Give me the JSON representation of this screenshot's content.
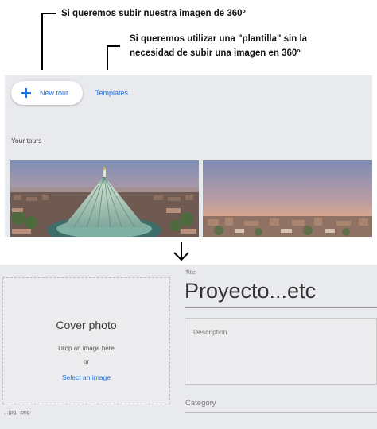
{
  "annotations": {
    "upload_360": "Si queremos subir nuestra imagen de 360º",
    "template_line1": "Si queremos utilizar una \"plantilla\" sin la",
    "template_line2": "necesidad de subir una imagen en 360º"
  },
  "tours_panel": {
    "new_tour_label": "New tour",
    "templates_label": "Templates",
    "section_title": "Your tours",
    "accent_color": "#1a73e8"
  },
  "details_panel": {
    "cover": {
      "title": "Cover photo",
      "drop_text": "Drop an image here",
      "or_text": "or",
      "select_label": "Select an image",
      "file_types": ", .jpg, .png"
    },
    "title_label": "Title",
    "title_value": "Proyecto...etc",
    "description_placeholder": "Description",
    "category_label": "Category"
  }
}
